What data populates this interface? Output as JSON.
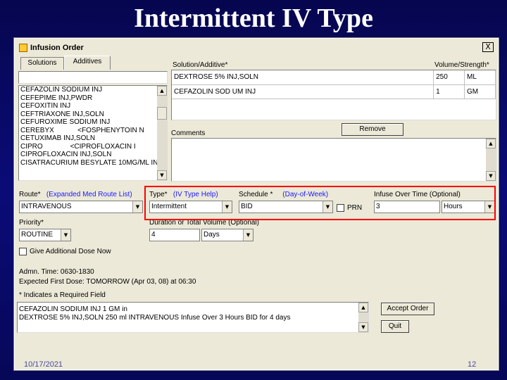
{
  "slide": {
    "title": "Intermittent IV Type",
    "date": "10/17/2021",
    "page": "12"
  },
  "dialog": {
    "title": "Infusion Order",
    "close_label": "X"
  },
  "tabs": [
    {
      "label": "Solutions"
    },
    {
      "label": "Additives"
    }
  ],
  "drug_list": [
    "CEFAZOLIN SODIUM INJ",
    "CEFEPIME INJ,PWDR",
    "CEFOXITIN INJ",
    "CEFTRIAXONE INJ,SOLN",
    "CEFUROXIME SODIUM INJ",
    "CEREBYX            <FOSPHENYTOIN N",
    "CETUXIMAB INJ,SOLN",
    "CIPRO              <CIPROFLOXACIN I",
    "CIPROFLOXACIN INJ,SOLN",
    "CISATRACURIUM BESYLATE 10MG/ML IN"
  ],
  "solution_table": {
    "header_solution": "Solution/Additive*",
    "header_volume": "Volume/Strength*",
    "rows": [
      {
        "name": "DEXTROSE 5% INJ,SOLN",
        "amount": "250",
        "unit": "ML"
      },
      {
        "name": "CEFAZOLIN SOD UM INJ",
        "amount": "1",
        "unit": "GM"
      }
    ]
  },
  "remove_label": "Remove",
  "comments_label": "Comments",
  "route": {
    "label": "Route*",
    "link": "(Expanded Med Route List)",
    "value": "INTRAVENOUS"
  },
  "type": {
    "label": "Type*",
    "link": "(IV Type Help)",
    "value": "Intermittent"
  },
  "schedule": {
    "label": "Schedule *",
    "link": "(Day-of-Week)",
    "value": "BID",
    "prn_label": "PRN"
  },
  "infuse": {
    "label": "Infuse Over Time (Optional)",
    "value": "3",
    "unit": "Hours"
  },
  "priority": {
    "label": "Priority*",
    "value": "ROUTINE"
  },
  "duration": {
    "label": "Duration or Total Volume (Optional)",
    "value": "4",
    "unit": "Days"
  },
  "additional_dose_label": "Give Additional Dose Now",
  "admin_time": "Admn. Time: 0630-1830",
  "first_dose": "Expected First Dose: TOMORROW (Apr 03, 08) at 06:30",
  "required_note": "* Indicates a Required Field",
  "summary_lines": [
    "CEFAZOLIN SODIUM INJ 1 GM in",
    "DEXTROSE 5% INJ,SOLN  250 ml INTRAVENOUS  Infuse Over 3 Hours  BID for 4 days"
  ],
  "accept_label": "Accept Order",
  "quit_label": "Quit",
  "colors": {
    "highlight": "#ff0000",
    "link": "#1a1aff",
    "slide_bg": "#0a0a6e"
  }
}
